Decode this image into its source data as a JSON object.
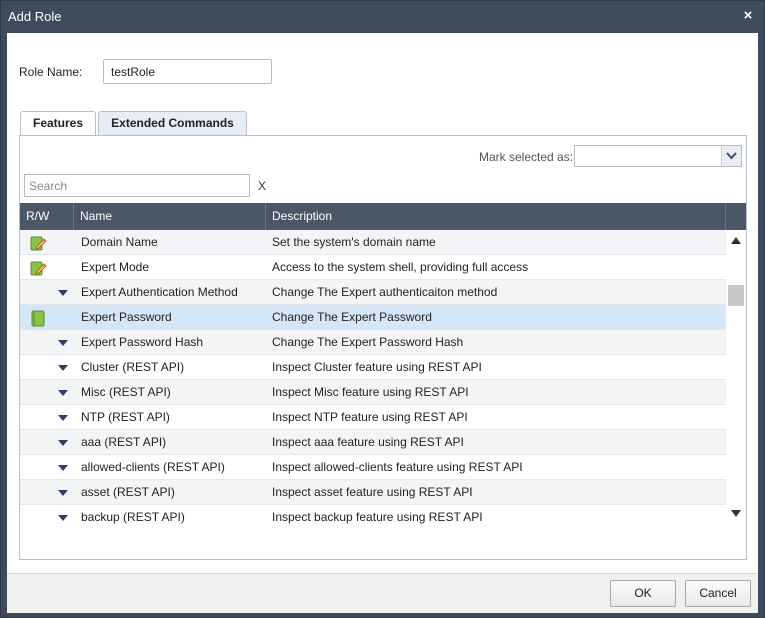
{
  "dialog": {
    "title": "Add Role",
    "close_label": "×"
  },
  "role_name": {
    "label": "Role Name:",
    "value": "testRole"
  },
  "tabs": [
    {
      "label": "Features",
      "active": true
    },
    {
      "label": "Extended Commands",
      "active": false
    }
  ],
  "toolbar": {
    "mark_label": "Mark selected as:",
    "mark_value": ""
  },
  "search": {
    "placeholder": "Search",
    "value": "",
    "clear_label": "X"
  },
  "grid": {
    "columns": {
      "rw": "R/W",
      "name": "Name",
      "description": "Description"
    },
    "rows": [
      {
        "rw": "pencil-icon",
        "name": "Domain Name",
        "description": "Set the system's domain name"
      },
      {
        "rw": "pencil-icon",
        "name": "Expert Mode",
        "description": "Access to the system shell, providing full access"
      },
      {
        "rw": "caret-down-icon",
        "name": "Expert Authentication Method",
        "description": "Change The Expert authenticaiton method"
      },
      {
        "rw": "book-icon",
        "name": "Expert Password",
        "description": "Change The Expert Password",
        "selected": true
      },
      {
        "rw": "caret-down-icon",
        "name": "Expert Password Hash",
        "description": "Change The Expert Password Hash"
      },
      {
        "rw": "caret-down-icon",
        "name": "Cluster (REST API)",
        "description": "Inspect Cluster feature using REST API"
      },
      {
        "rw": "caret-down-icon",
        "name": "Misc (REST API)",
        "description": "Inspect Misc feature using REST API"
      },
      {
        "rw": "caret-down-icon",
        "name": "NTP (REST API)",
        "description": "Inspect NTP feature using REST API"
      },
      {
        "rw": "caret-down-icon",
        "name": "aaa (REST API)",
        "description": "Inspect aaa feature using REST API"
      },
      {
        "rw": "caret-down-icon",
        "name": "allowed-clients (REST API)",
        "description": "Inspect allowed-clients feature using REST API"
      },
      {
        "rw": "caret-down-icon",
        "name": "asset (REST API)",
        "description": "Inspect asset feature using REST API"
      },
      {
        "rw": "caret-down-icon",
        "name": "backup (REST API)",
        "description": "Inspect backup feature using REST API"
      }
    ]
  },
  "buttons": {
    "ok": "OK",
    "cancel": "Cancel"
  },
  "colors": {
    "titlebar": "#3e4b5c",
    "grid_header": "#4b5667",
    "selected_row": "#d5e6f6",
    "caret": "#2c3e6b",
    "icon_green": "#8bc34a"
  }
}
